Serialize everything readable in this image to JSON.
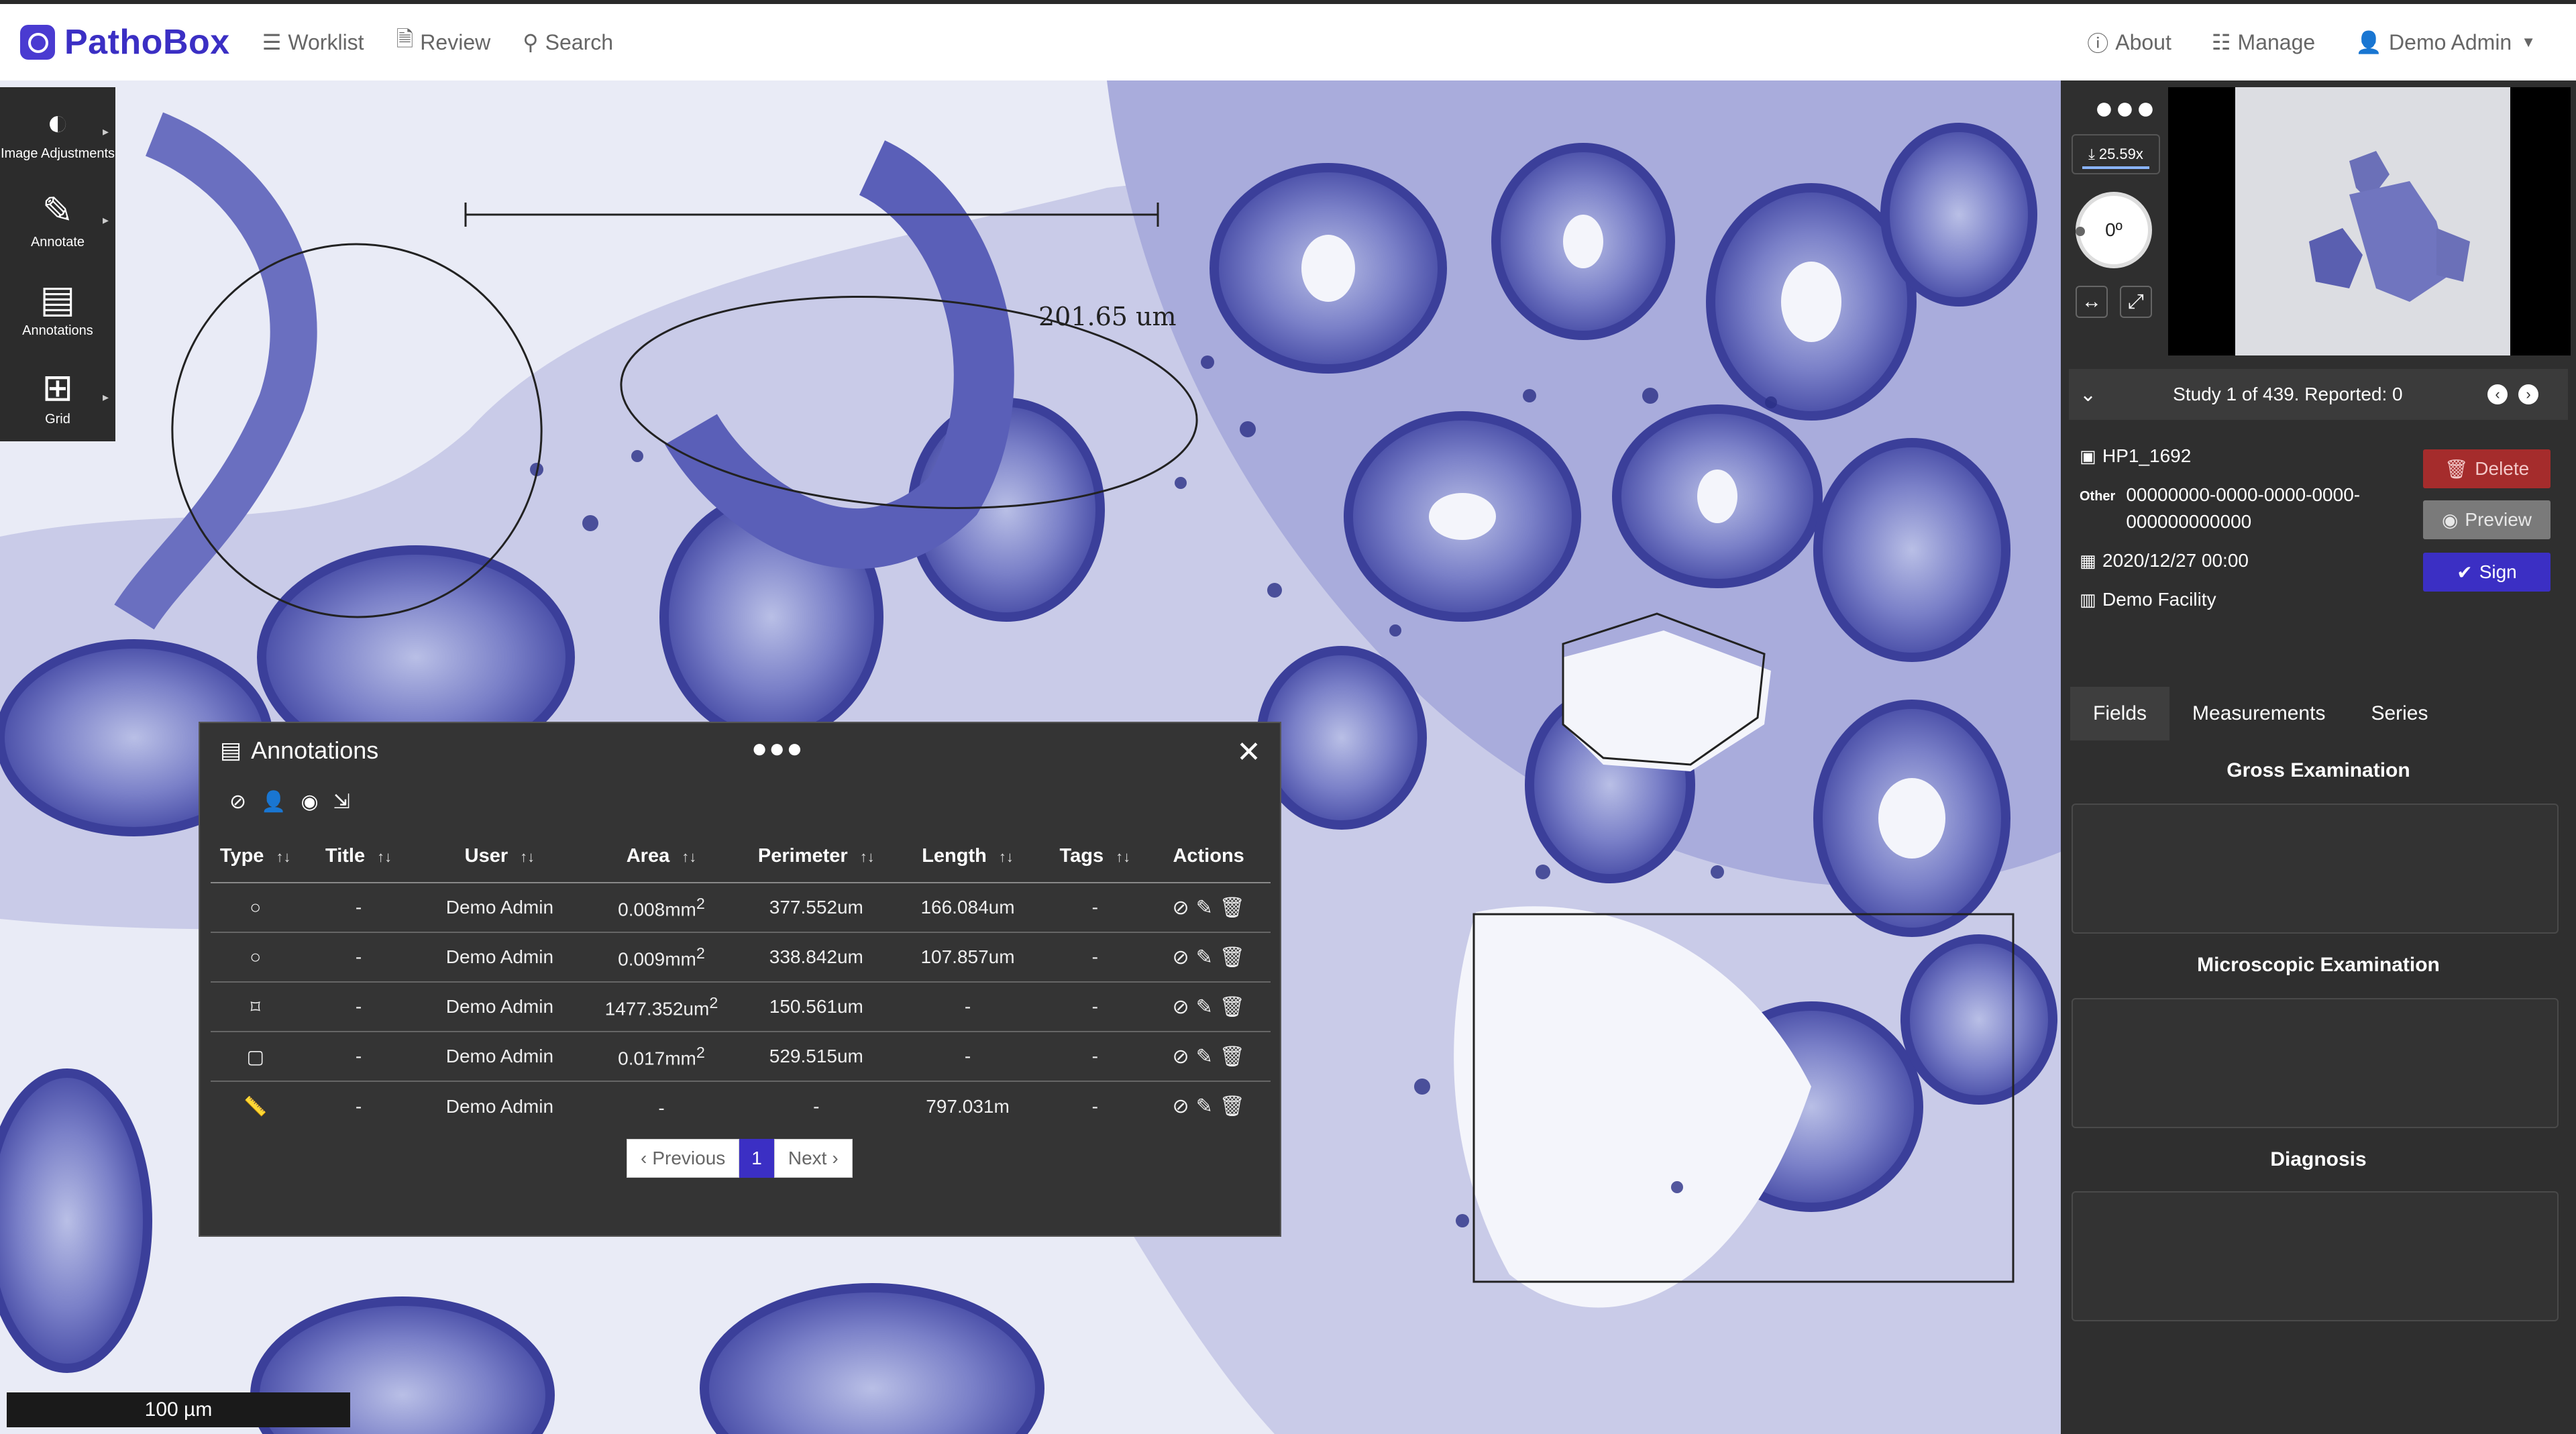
{
  "app": {
    "name": "PathoBox"
  },
  "nav": {
    "worklist": "Worklist",
    "review": "Review",
    "search": "Search",
    "about": "About",
    "manage": "Manage",
    "user": "Demo Admin"
  },
  "toolbar": [
    {
      "label": "Image Adjustments",
      "icon": "contrast-icon"
    },
    {
      "label": "Annotate",
      "icon": "pencil-icon"
    },
    {
      "label": "Annotations",
      "icon": "list-icon"
    },
    {
      "label": "Grid",
      "icon": "grid-icon"
    }
  ],
  "viewer": {
    "measurement_label": "201.65 um",
    "scale_bar": "100 µm"
  },
  "annotations_panel": {
    "title": "Annotations",
    "columns": [
      "Type",
      "Title",
      "User",
      "Area",
      "Perimeter",
      "Length",
      "Tags",
      "Actions"
    ],
    "rows": [
      {
        "type": "ellipse",
        "title": "-",
        "user": "Demo Admin",
        "area": "0.008mm",
        "area_sup": "2",
        "perimeter": "377.552um",
        "length": "166.084um",
        "tags": "-"
      },
      {
        "type": "ellipse",
        "title": "-",
        "user": "Demo Admin",
        "area": "0.009mm",
        "area_sup": "2",
        "perimeter": "338.842um",
        "length": "107.857um",
        "tags": "-"
      },
      {
        "type": "polygon",
        "title": "-",
        "user": "Demo Admin",
        "area": "1477.352um",
        "area_sup": "2",
        "perimeter": "150.561um",
        "length": "-",
        "tags": "-"
      },
      {
        "type": "rectangle",
        "title": "-",
        "user": "Demo Admin",
        "area": "0.017mm",
        "area_sup": "2",
        "perimeter": "529.515um",
        "length": "-",
        "tags": "-"
      },
      {
        "type": "ruler",
        "title": "-",
        "user": "Demo Admin",
        "area": "-",
        "area_sup": "",
        "perimeter": "-",
        "length": "797.031m",
        "tags": "-"
      }
    ],
    "pager": {
      "previous": "Previous",
      "current": "1",
      "next": "Next"
    }
  },
  "sidebar": {
    "zoom": "25.59x",
    "rotation": "0º",
    "study": "Study 1 of 439. Reported: 0",
    "case_id": "HP1_1692",
    "id_tag": "Other",
    "uid": "00000000-0000-0000-0000-000000000000",
    "date": "2020/12/27 00:00",
    "facility": "Demo Facility",
    "buttons": {
      "delete": "Delete",
      "preview": "Preview",
      "sign": "Sign"
    },
    "tabs": [
      "Fields",
      "Measurements",
      "Series"
    ],
    "fields": [
      "Gross Examination",
      "Microscopic Examination",
      "Diagnosis"
    ]
  }
}
